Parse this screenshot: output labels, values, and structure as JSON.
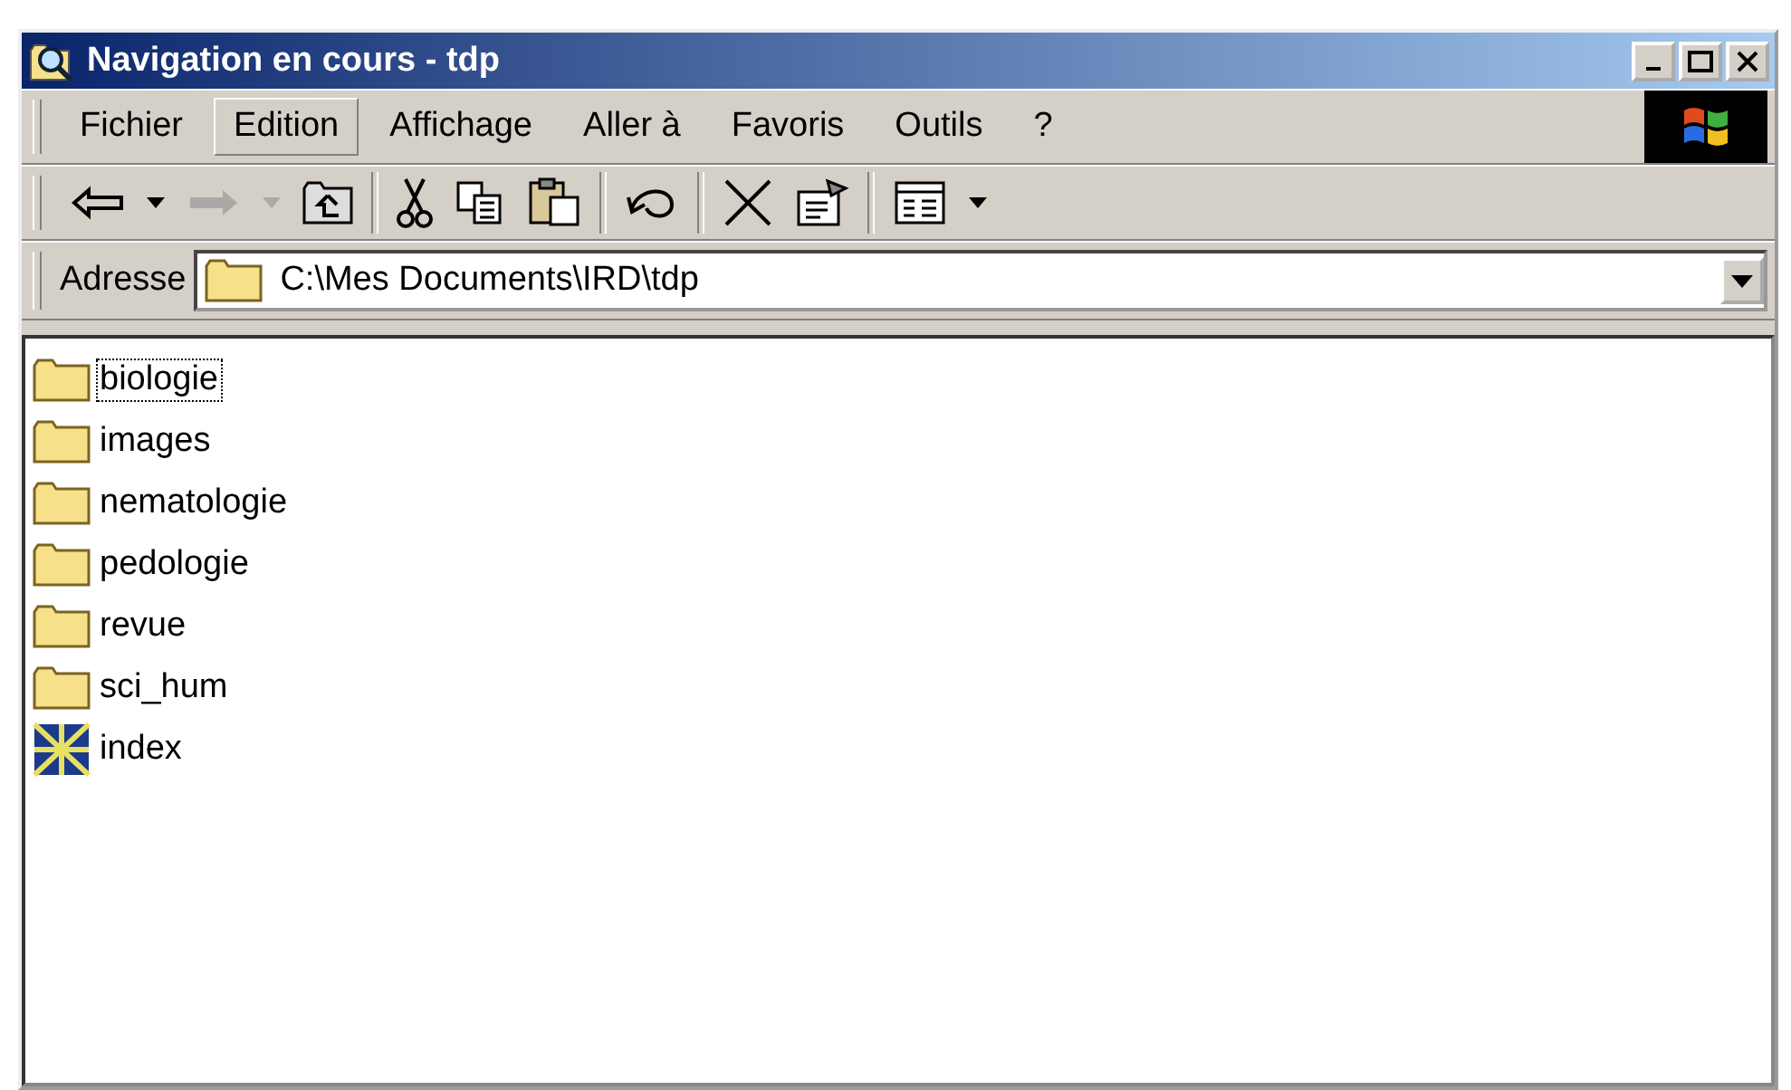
{
  "window": {
    "title": "Navigation en cours - tdp"
  },
  "menu": [
    {
      "label": "Fichier",
      "selected": false
    },
    {
      "label": "Edition",
      "selected": true
    },
    {
      "label": "Affichage",
      "selected": false
    },
    {
      "label": "Aller à",
      "selected": false
    },
    {
      "label": "Favoris",
      "selected": false
    },
    {
      "label": "Outils",
      "selected": false
    },
    {
      "label": "?",
      "selected": false
    }
  ],
  "toolbar": [
    {
      "kind": "back",
      "disabled": false
    },
    {
      "kind": "dropdown",
      "disabled": false
    },
    {
      "kind": "forward",
      "disabled": true
    },
    {
      "kind": "dropdown",
      "disabled": true
    },
    {
      "kind": "up",
      "disabled": false
    },
    {
      "kind": "separator"
    },
    {
      "kind": "cut",
      "disabled": false
    },
    {
      "kind": "copy",
      "disabled": false
    },
    {
      "kind": "paste",
      "disabled": false
    },
    {
      "kind": "separator"
    },
    {
      "kind": "undo",
      "disabled": false
    },
    {
      "kind": "separator"
    },
    {
      "kind": "delete",
      "disabled": false
    },
    {
      "kind": "properties",
      "disabled": false
    },
    {
      "kind": "separator"
    },
    {
      "kind": "views",
      "disabled": false
    },
    {
      "kind": "dropdown",
      "disabled": false
    }
  ],
  "address": {
    "label": "Adresse",
    "value": "C:\\Mes Documents\\IRD\\tdp"
  },
  "files": [
    {
      "name": "biologie",
      "kind": "folder",
      "focused": true
    },
    {
      "name": "images",
      "kind": "folder",
      "focused": false
    },
    {
      "name": "nematologie",
      "kind": "folder",
      "focused": false
    },
    {
      "name": "pedologie",
      "kind": "folder",
      "focused": false
    },
    {
      "name": "revue",
      "kind": "folder",
      "focused": false
    },
    {
      "name": "sci_hum",
      "kind": "folder",
      "focused": false
    },
    {
      "name": "index",
      "kind": "web",
      "focused": false
    }
  ]
}
